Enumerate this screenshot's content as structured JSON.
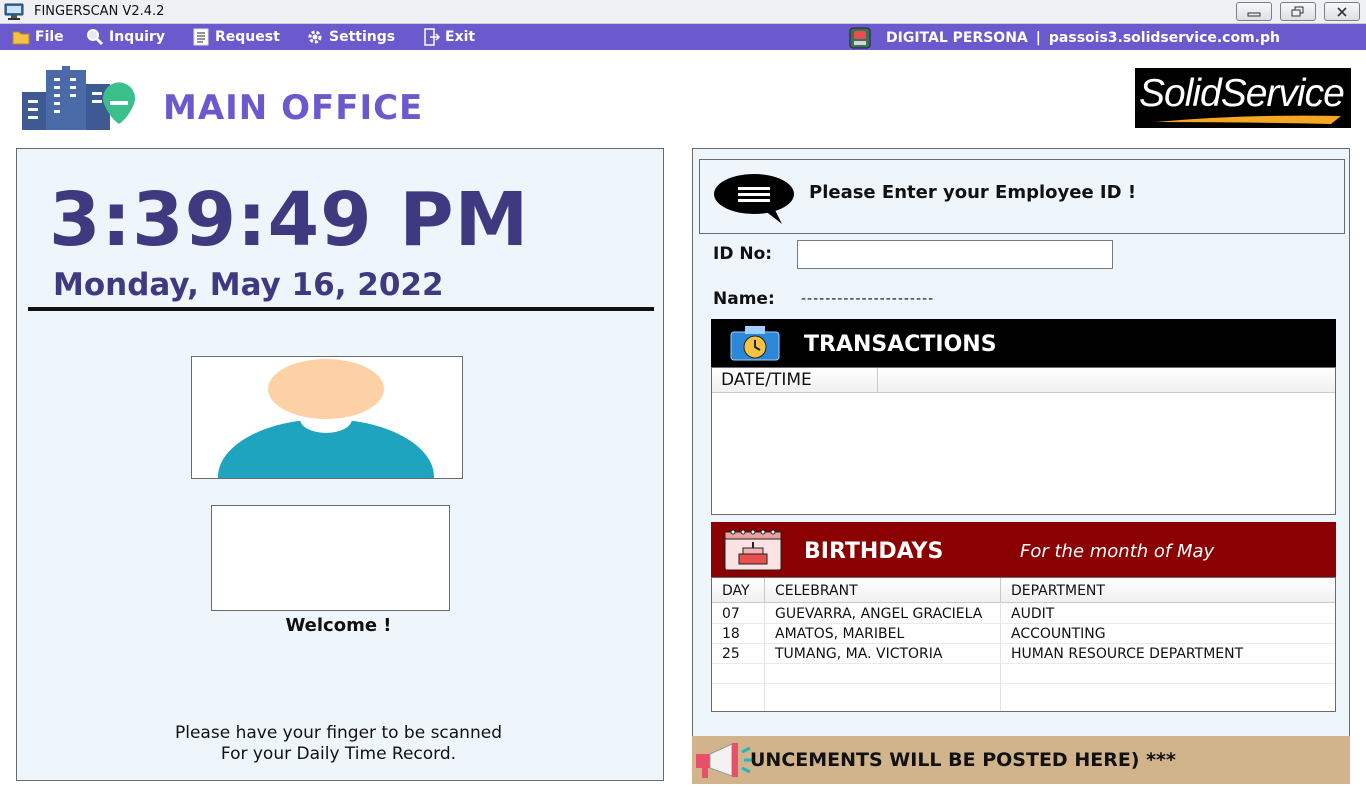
{
  "window": {
    "title": "FINGERSCAN V2.4.2",
    "icon": "app-icon"
  },
  "menu": {
    "items": [
      {
        "label": "File",
        "icon": "folder-icon"
      },
      {
        "label": "Inquiry",
        "icon": "magnifier-icon"
      },
      {
        "label": "Request",
        "icon": "document-list-icon"
      },
      {
        "label": "Settings",
        "icon": "gear-icon"
      },
      {
        "label": "Exit",
        "icon": "exit-door-icon"
      }
    ],
    "device": "DIGITAL PERSONA",
    "separator": "|",
    "server": "passois3.solidservice.com.ph"
  },
  "header": {
    "office": "MAIN OFFICE",
    "brand": "SolidService",
    "accent": "#6a5acd"
  },
  "clock": {
    "time": "3:39:49 PM",
    "date": "Monday, May 16, 2022"
  },
  "scan": {
    "welcome": "Welcome !",
    "instruction_line1": "Please have your finger to be scanned",
    "instruction_line2": "For your Daily Time Record."
  },
  "employee": {
    "prompt": "Please Enter your Employee ID !",
    "id_label": "ID No:",
    "id_value": "",
    "name_label": "Name:",
    "name_value": "----------------------"
  },
  "transactions": {
    "title": "TRANSACTIONS",
    "columns": [
      "DATE/TIME"
    ],
    "rows": []
  },
  "birthdays": {
    "title": "BIRTHDAYS",
    "subtitle": "For the month of May",
    "header_color": "#8b0000",
    "columns": [
      "DAY",
      "CELEBRANT",
      "DEPARTMENT"
    ],
    "rows": [
      {
        "day": "07",
        "celebrant": "GUEVARRA, ANGEL GRACIELA",
        "department": "AUDIT"
      },
      {
        "day": "18",
        "celebrant": "AMATOS, MARIBEL",
        "department": "ACCOUNTING"
      },
      {
        "day": "25",
        "celebrant": "TUMANG, MA. VICTORIA",
        "department": "HUMAN RESOURCE DEPARTMENT"
      }
    ]
  },
  "announcement": {
    "text": "UNCEMENTS WILL BE POSTED HERE) ***",
    "background": "#d2b48c"
  }
}
